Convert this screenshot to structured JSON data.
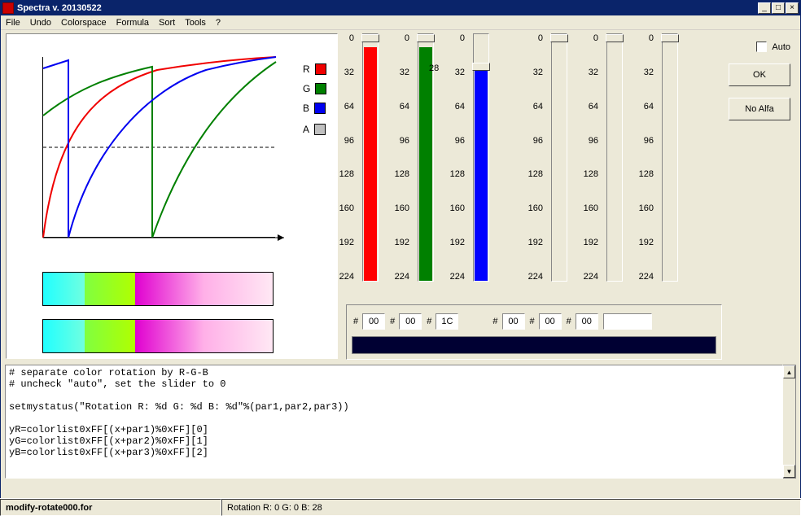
{
  "window": {
    "title": "Spectra v. 20130522"
  },
  "menu": {
    "items": [
      "File",
      "Undo",
      "Colorspace",
      "Formula",
      "Sort",
      "Tools",
      "?"
    ]
  },
  "legend": {
    "items": [
      {
        "label": "R",
        "color": "#f00000"
      },
      {
        "label": "G",
        "color": "#008000"
      },
      {
        "label": "B",
        "color": "#0000f0"
      },
      {
        "label": "A",
        "color": "#c0c0c0"
      }
    ]
  },
  "tick_values": [
    "0",
    "32",
    "64",
    "96",
    "128",
    "160",
    "192",
    "224"
  ],
  "sliders": [
    {
      "fill_top": 16,
      "fill_color": "#ff0000",
      "thumb_top": 0,
      "side_label": ""
    },
    {
      "fill_top": 16,
      "fill_color": "#008000",
      "thumb_top": 0,
      "side_label": ""
    },
    {
      "fill_top": 45,
      "fill_color": "#0000ff",
      "thumb_top": 35,
      "side_label": "28"
    },
    {
      "fill_top": 305,
      "fill_color": "transparent",
      "thumb_top": 0,
      "side_label": ""
    },
    {
      "fill_top": 305,
      "fill_color": "transparent",
      "thumb_top": 0,
      "side_label": ""
    },
    {
      "fill_top": 305,
      "fill_color": "transparent",
      "thumb_top": 0,
      "side_label": ""
    }
  ],
  "hex": {
    "hash": "#",
    "values": [
      "00",
      "00",
      "1C",
      "00",
      "00",
      "00"
    ],
    "combined": ""
  },
  "color_strip": "#000033",
  "controls": {
    "auto_label": "Auto",
    "auto_checked": false,
    "ok_label": "OK",
    "noalfa_label": "No Alfa"
  },
  "code_text": "# separate color rotation by R-G-B\n# uncheck \"auto\", set the slider to 0\n\nsetmystatus(\"Rotation R: %d G: %d B: %d\"%(par1,par2,par3))\n\nyR=colorlist0xFF[(x+par1)%0xFF][0]\nyG=colorlist0xFF[(x+par2)%0xFF][1]\nyB=colorlist0xFF[(x+par3)%0xFF][2]",
  "statusbar": {
    "file": "modify-rotate000.for",
    "status": "Rotation R: 0 G: 0 B: 28"
  },
  "chart_data": {
    "type": "line",
    "xlim": [
      0,
      255
    ],
    "ylim": [
      0,
      255
    ],
    "series": [
      {
        "name": "R",
        "color": "#f00000",
        "x": [
          0,
          32,
          64,
          96,
          128,
          160,
          192,
          224,
          255
        ],
        "y": [
          0,
          164,
          192,
          210,
          224,
          235,
          244,
          250,
          255
        ]
      },
      {
        "name": "G",
        "color": "#008000",
        "segments": [
          {
            "x": [
              0,
              32,
              64,
              96,
              120
            ],
            "y": [
              172,
              200,
              218,
              232,
              240
            ]
          },
          {
            "x": [
              120,
              160,
              192,
              224,
              255
            ],
            "y": [
              0,
              120,
              170,
              210,
              250
            ]
          }
        ]
      },
      {
        "name": "B",
        "color": "#0000f0",
        "segments": [
          {
            "x": [
              0,
              28
            ],
            "y": [
              242,
              252
            ]
          },
          {
            "x": [
              28,
              64,
              96,
              128,
              160,
              192,
              224,
              255
            ],
            "y": [
              0,
              130,
              178,
              208,
              228,
              240,
              250,
              255
            ]
          }
        ]
      }
    ],
    "annotations": [
      {
        "type": "hline",
        "y": 128,
        "style": "dashed"
      }
    ]
  }
}
